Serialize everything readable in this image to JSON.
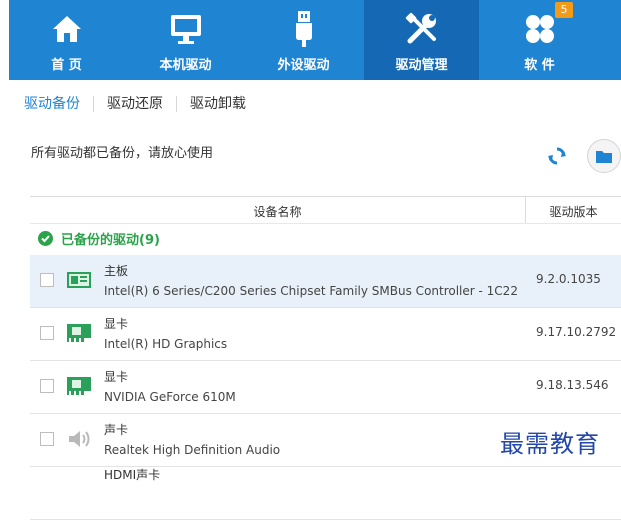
{
  "nav": {
    "items": [
      {
        "label": "首 页",
        "icon": "home-icon"
      },
      {
        "label": "本机驱动",
        "icon": "monitor-icon"
      },
      {
        "label": "外设驱动",
        "icon": "usb-icon"
      },
      {
        "label": "驱动管理",
        "icon": "tools-icon"
      },
      {
        "label": "软 件",
        "icon": "apps-icon",
        "badge": "5"
      }
    ],
    "active_index": 3
  },
  "subtabs": [
    "驱动备份",
    "驱动还原",
    "驱动卸载"
  ],
  "status_text": "所有驱动都已备份，请放心使用",
  "table": {
    "col_name": "设备名称",
    "col_version": "驱动版本",
    "group_label": "已备份的驱动(9)",
    "rows": [
      {
        "category": "主板",
        "name": "Intel(R) 6 Series/C200 Series Chipset Family SMBus Controller - 1C22",
        "version": "9.2.0.1035",
        "icon": "motherboard-icon"
      },
      {
        "category": "显卡",
        "name": "Intel(R) HD Graphics",
        "version": "9.17.10.2792",
        "icon": "graphics-card-icon"
      },
      {
        "category": "显卡",
        "name": "NVIDIA GeForce 610M",
        "version": "9.18.13.546",
        "icon": "graphics-card-icon"
      },
      {
        "category": "声卡",
        "name": "Realtek High Definition Audio",
        "version": "",
        "icon": "speaker-icon"
      },
      {
        "category": "HDMI声卡",
        "name": "",
        "version": "",
        "icon": ""
      }
    ]
  },
  "watermark": "最需教育",
  "colors": {
    "brand_blue": "#1f84d2",
    "active_blue": "#1569b4",
    "ok_green": "#2ca24a",
    "badge_orange": "#f39b18"
  }
}
